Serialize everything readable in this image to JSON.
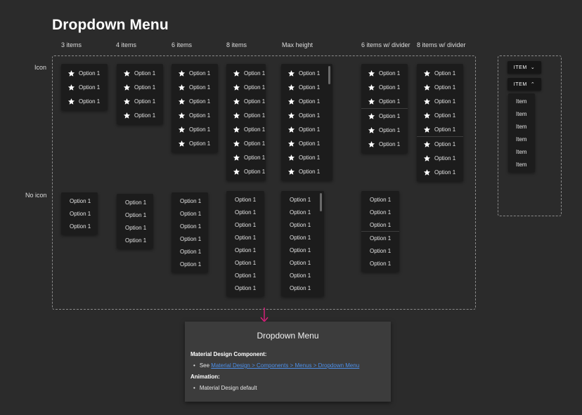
{
  "page_title": "Dropdown Menu",
  "columns": [
    "3 items",
    "4 items",
    "6 items",
    "8 items",
    "Max height",
    "6 items w/ divider",
    "8 items w/ divider"
  ],
  "rows": [
    "Icon",
    "No icon"
  ],
  "menu_option_label": "Option 1",
  "icon_name": "star-icon",
  "side_example": {
    "button_label": "ITEM",
    "item_label": "Item",
    "item_count": 6
  },
  "panel": {
    "title": "Dropdown Menu",
    "section1_heading": "Material Design Component:",
    "section1_prefix": "See ",
    "section1_link": "Material Design > Components > Menus > Dropdown Menu",
    "section2_heading": "Animation:",
    "section2_item": "Material Design default"
  },
  "colors": {
    "background": "#2b2b2b",
    "menu": "#1c1c1c",
    "panel": "#3c3c3c",
    "link": "#4d8fe8",
    "arrow": "#e0217f"
  }
}
